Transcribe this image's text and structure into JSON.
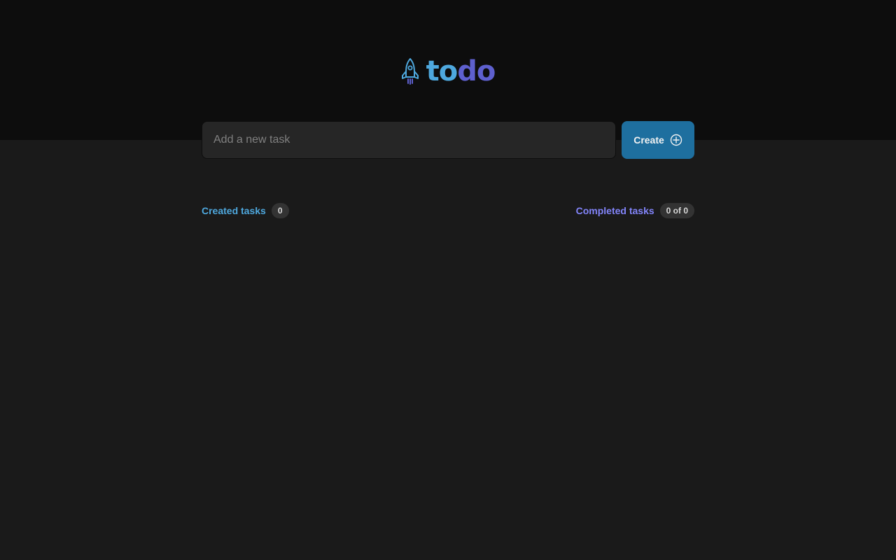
{
  "app": {
    "logo_text_a": "to",
    "logo_text_b": "do",
    "logo_icon": "rocket-icon"
  },
  "form": {
    "input_placeholder": "Add a new task",
    "input_value": "",
    "create_label": "Create",
    "create_icon": "plus-circle-icon"
  },
  "counters": {
    "created_label": "Created tasks",
    "created_count": "0",
    "completed_label": "Completed tasks",
    "completed_count": "0 of 0"
  },
  "colors": {
    "header_bg": "#0d0d0d",
    "page_bg": "#1a1a1a",
    "brand_blue": "#4ea8de",
    "brand_purple": "#5e60ce",
    "completed_purple": "#8284fa",
    "button_blue": "#1e6f9f"
  }
}
